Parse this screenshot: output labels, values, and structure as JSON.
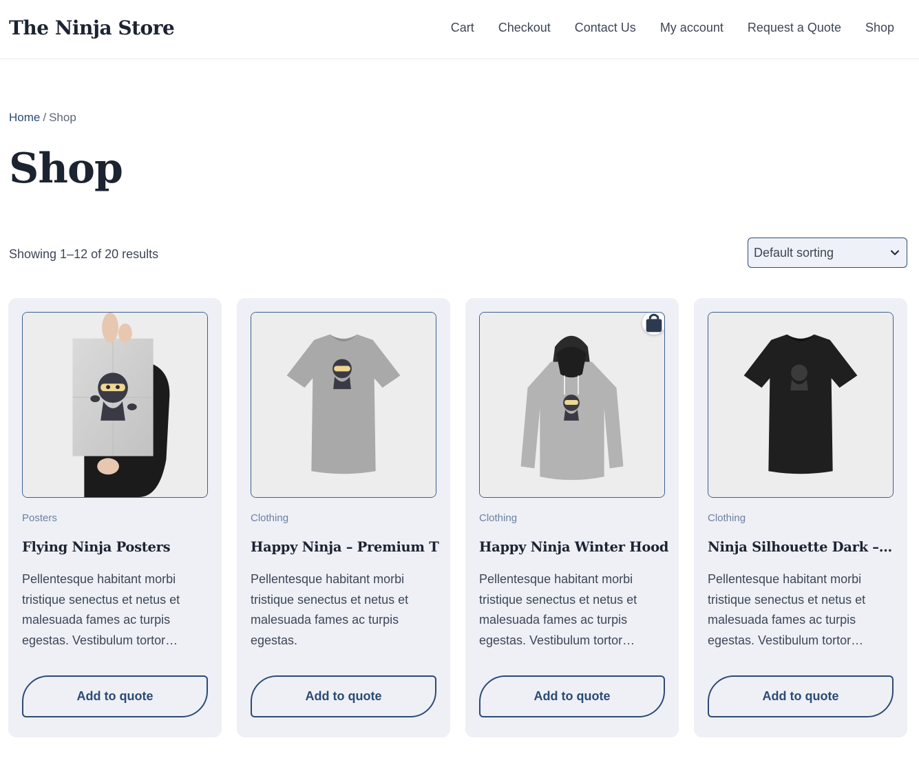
{
  "header": {
    "brand": "The Ninja Store",
    "nav": [
      "Cart",
      "Checkout",
      "Contact Us",
      "My account",
      "Request a Quote",
      "Shop"
    ]
  },
  "breadcrumb": {
    "home": "Home",
    "separator": "/",
    "current": "Shop"
  },
  "page_title": "Shop",
  "toolbar": {
    "result_count": "Showing 1–12 of 20 results",
    "sort_value": "Default sorting"
  },
  "products": [
    {
      "category": "Posters",
      "title": "Flying Ninja Posters",
      "description": "Pellentesque habitant morbi tristique senectus et netus et malesuada fames ac turpis egestas. Vestibulum tortor…",
      "button": "Add to quote",
      "image": "poster"
    },
    {
      "category": "Clothing",
      "title": "Happy Ninja – Premium T…",
      "description": "Pellentesque habitant morbi tristique senectus et netus et malesuada fames ac turpis egestas.",
      "button": "Add to quote",
      "image": "tshirt-grey"
    },
    {
      "category": "Clothing",
      "title": "Happy Ninja Winter Hoodies",
      "description": "Pellentesque habitant morbi tristique senectus et netus et malesuada fames ac turpis egestas. Vestibulum tortor…",
      "button": "Add to quote",
      "image": "hoodie",
      "badge_icon": "shopping-bag-icon"
    },
    {
      "category": "Clothing",
      "title": "Ninja Silhouette Dark –…",
      "description": "Pellentesque habitant morbi tristique senectus et netus et malesuada fames ac turpis egestas. Vestibulum tortor…",
      "button": "Add to quote",
      "image": "tshirt-dark"
    }
  ],
  "colors": {
    "accent": "#2c4a73",
    "card_bg": "#eef0f6",
    "category": "#6c7fa3"
  }
}
